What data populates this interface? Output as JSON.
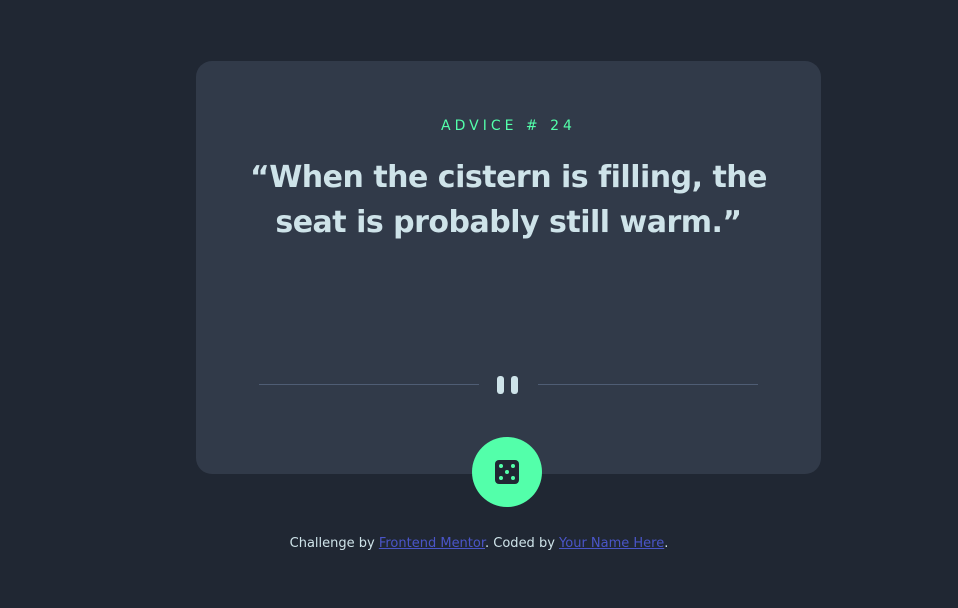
{
  "card": {
    "advice_label": "ADVICE # 24",
    "quote": "“When the cistern is filling, the seat is probably still warm.”"
  },
  "divider": {
    "icon": "pause-icon"
  },
  "button": {
    "icon": "dice-icon"
  },
  "footer": {
    "challenge_prefix": "Challenge by ",
    "challenge_link": "Frontend Mentor",
    "coded_prefix": ". Coded by ",
    "coded_link": "Your Name Here",
    "suffix": "."
  },
  "colors": {
    "background": "#202733",
    "card": "#313a49",
    "accent": "#53ffaa",
    "text": "#cee3e9",
    "divider": "#4f5d74",
    "link": "#4a55c8"
  }
}
